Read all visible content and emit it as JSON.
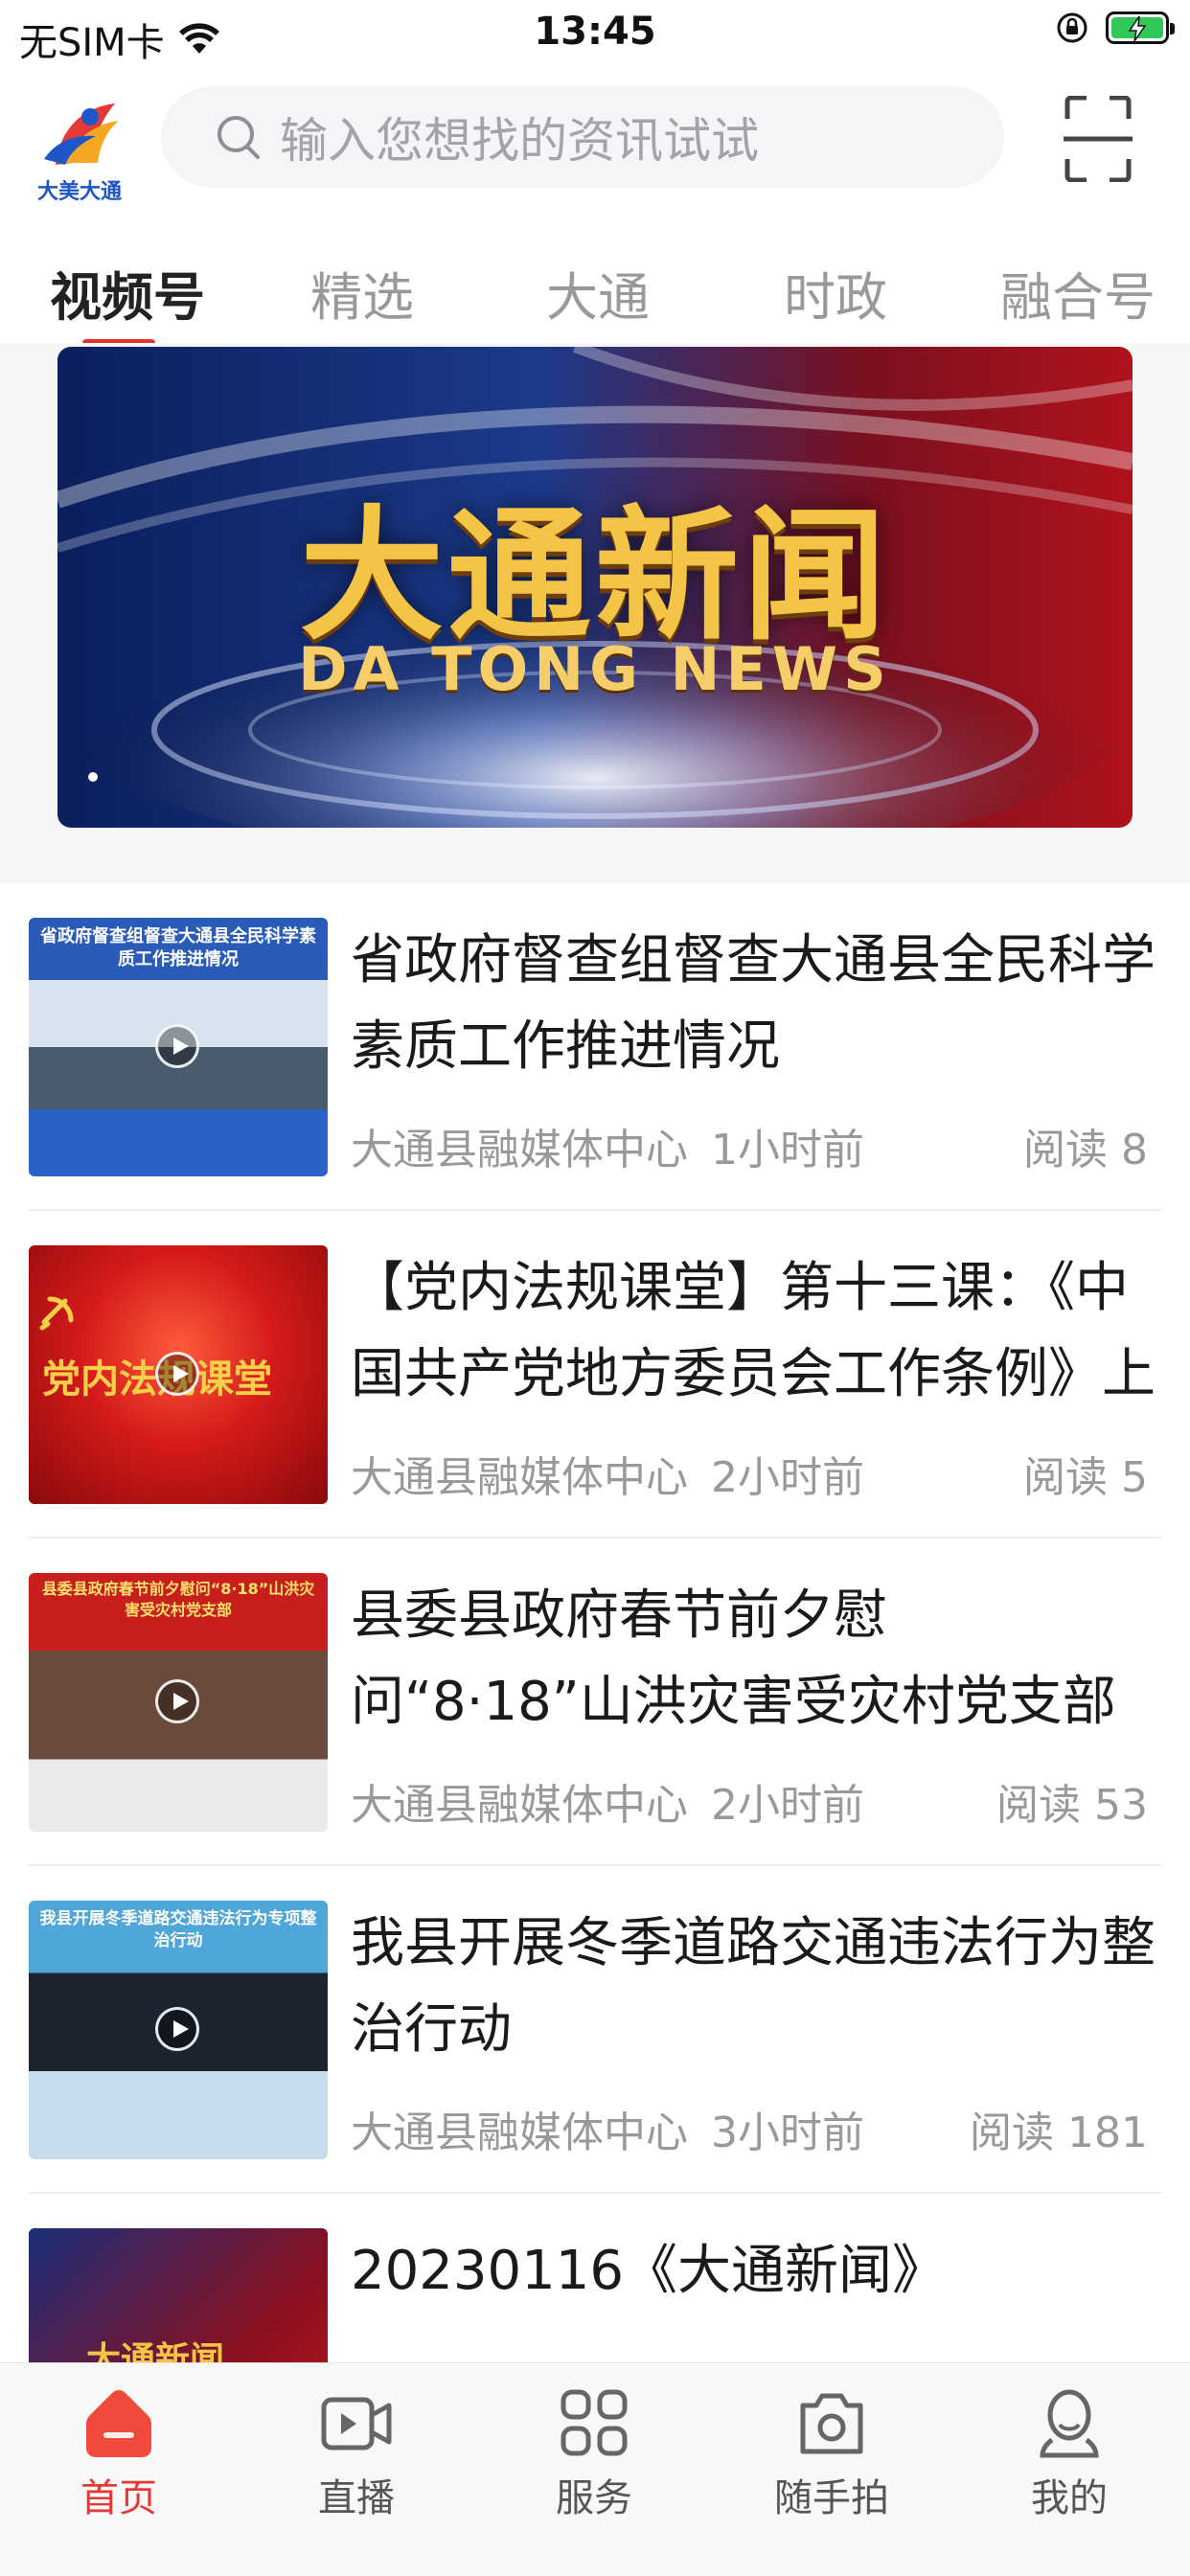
{
  "status_bar": {
    "carrier": "无SIM卡",
    "time": "13:45"
  },
  "header": {
    "logo_text": "大美大通",
    "search_placeholder": "输入您想找的资讯试试"
  },
  "tabs": [
    {
      "label": "视频号",
      "active": true
    },
    {
      "label": "精选",
      "active": false
    },
    {
      "label": "大通",
      "active": false
    },
    {
      "label": "时政",
      "active": false
    },
    {
      "label": "融合号",
      "active": false
    }
  ],
  "banner": {
    "title": "大通新闻",
    "subtitle": "DA TONG NEWS"
  },
  "news": [
    {
      "title": "省政府督查组督查大通县全民科学素质工作推进情况",
      "source": "大通县融媒体中心",
      "time": "1小时前",
      "reads": "阅读 8",
      "thumb_text": "省政府督查组督查大通县全民科学素质工作推进情况"
    },
    {
      "title": "【党内法规课堂】第十三课：《中国共产党地方委员会工作条例》上",
      "source": "大通县融媒体中心",
      "time": "2小时前",
      "reads": "阅读 5",
      "thumb_text": "党内法规课堂"
    },
    {
      "title": "县委县政府春节前夕慰问“8·18”山洪灾害受灾村党支部",
      "source": "大通县融媒体中心",
      "time": "2小时前",
      "reads": "阅读 53",
      "thumb_text": "县委县政府春节前夕慰问“8·18”山洪灾害受灾村党支部"
    },
    {
      "title": "我县开展冬季道路交通违法行为整治行动",
      "source": "大通县融媒体中心",
      "time": "3小时前",
      "reads": "阅读 181",
      "thumb_text": "我县开展冬季道路交通违法行为专项整治行动"
    },
    {
      "title": "20230116《大通新闻》",
      "source": "",
      "time": "",
      "reads": "",
      "thumb_text": "大通新闻"
    }
  ],
  "bottom_nav": [
    {
      "label": "首页",
      "icon": "home-icon",
      "active": true
    },
    {
      "label": "直播",
      "icon": "live-icon",
      "active": false
    },
    {
      "label": "服务",
      "icon": "services-icon",
      "active": false
    },
    {
      "label": "随手拍",
      "icon": "camera-icon",
      "active": false
    },
    {
      "label": "我的",
      "icon": "profile-icon",
      "active": false
    }
  ],
  "colors": {
    "accent": "#e5312e",
    "battery": "#31c759"
  }
}
